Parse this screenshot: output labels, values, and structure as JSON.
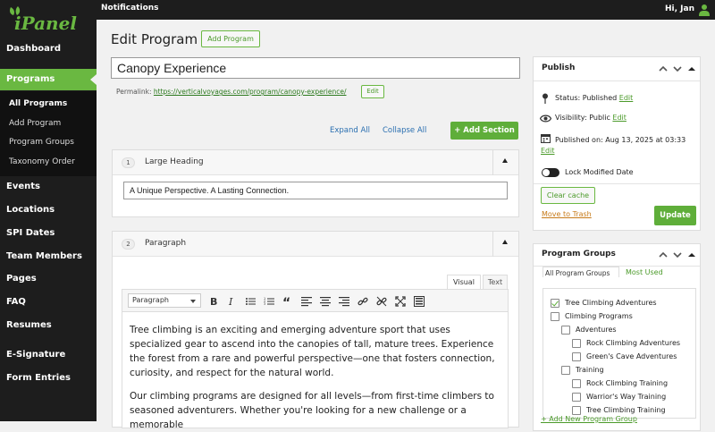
{
  "topbar": {
    "notifications": "Notifications",
    "greeting": "Hi, Jan"
  },
  "logo": {
    "text": "iPanel",
    "color": "#6ab841"
  },
  "sidebar": {
    "items": [
      {
        "label": "Dashboard"
      },
      {
        "label": "Programs",
        "active": true
      },
      {
        "label": "Events"
      },
      {
        "label": "Locations"
      },
      {
        "label": "SPI Dates"
      },
      {
        "label": "Team Members"
      },
      {
        "label": "Pages"
      },
      {
        "label": "FAQ"
      },
      {
        "label": "Resumes"
      },
      {
        "label": "E-Signature"
      },
      {
        "label": "Form Entries"
      }
    ],
    "subitems": [
      {
        "label": "All Programs",
        "current": true
      },
      {
        "label": "Add Program"
      },
      {
        "label": "Program Groups"
      },
      {
        "label": "Taxonomy Order"
      }
    ]
  },
  "page": {
    "title": "Edit Program",
    "add_button": "Add Program"
  },
  "post": {
    "title": "Canopy Experience",
    "permalink_label": "Permalink:",
    "permalink_url": "https://verticalvoyages.com/program/canopy-experience/",
    "permalink_edit": "Edit"
  },
  "sections_bar": {
    "expand": "Expand All",
    "collapse": "Collapse All",
    "add_section": "+ Add Section"
  },
  "sections": [
    {
      "number": "1",
      "label": "Large Heading",
      "value": "A Unique Perspective. A Lasting Connection."
    },
    {
      "number": "2",
      "label": "Paragraph"
    }
  ],
  "editor": {
    "tab_visual": "Visual",
    "tab_text": "Text",
    "format": "Paragraph",
    "paragraphs": [
      "Tree climbing is an exciting and emerging adventure sport that uses specialized gear to ascend into the canopies of tall, mature trees. Experience the forest from a rare and powerful perspective—one that fosters connection, curiosity, and respect for the natural world.",
      "Our climbing programs are designed for all levels—from first-time climbers to seasoned adventurers. Whether you're looking for a new challenge or a memorable"
    ]
  },
  "publish": {
    "title": "Publish",
    "status_label": "Status:",
    "status_value": "Published",
    "visibility_label": "Visibility:",
    "visibility_value": "Public",
    "published_label": "Published on:",
    "published_value": "Aug 13, 2025 at 03:33",
    "edit": "Edit",
    "lock_label": "Lock Modified Date",
    "clear_cache": "Clear cache",
    "trash": "Move to Trash",
    "update": "Update"
  },
  "groups": {
    "title": "Program Groups",
    "tab_all": "All Program Groups",
    "tab_most": "Most Used",
    "items": [
      {
        "label": "Tree Climbing Adventures",
        "checked": true,
        "level": 0
      },
      {
        "label": "Climbing Programs",
        "checked": false,
        "level": 0
      },
      {
        "label": "Adventures",
        "checked": false,
        "level": 1
      },
      {
        "label": "Rock Climbing Adventures",
        "checked": false,
        "level": 2
      },
      {
        "label": "Green's Cave Adventures",
        "checked": false,
        "level": 2
      },
      {
        "label": "Training",
        "checked": false,
        "level": 1
      },
      {
        "label": "Rock Climbing Training",
        "checked": false,
        "level": 2
      },
      {
        "label": "Warrior's Way Training",
        "checked": false,
        "level": 2
      },
      {
        "label": "Tree Climbing Training",
        "checked": false,
        "level": 2
      }
    ],
    "add_new": "+ Add New Program Group"
  },
  "colors": {
    "accent": "#6ab841",
    "sidebar": "#1d1d1d"
  }
}
